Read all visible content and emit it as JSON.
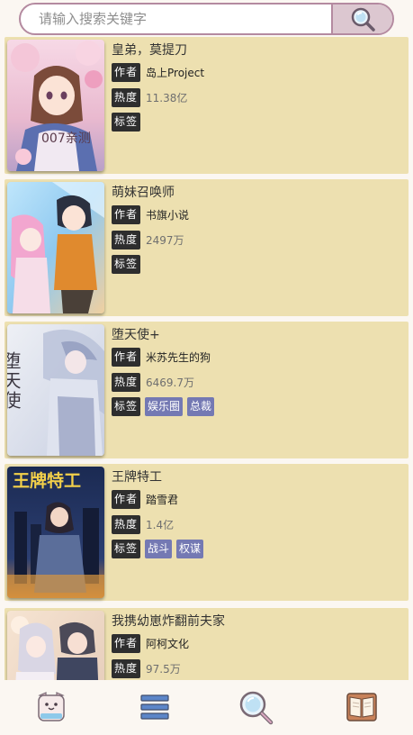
{
  "search": {
    "placeholder": "请输入搜索关键字"
  },
  "labels": {
    "author": "作者",
    "popularity": "热度",
    "tags": "标签"
  },
  "comics": [
    {
      "title": "皇弟，莫提刀",
      "author": "岛上Project",
      "popularity": "11.38亿",
      "tags": [],
      "cover_watermark": "007亲测"
    },
    {
      "title": "萌妹召唤师",
      "author": "书旗小说",
      "popularity": "2497万",
      "tags": []
    },
    {
      "title": "堕天使+",
      "author": "米苏先生的狗",
      "popularity": "6469.7万",
      "tags": [
        "娱乐圈",
        "总裁"
      ],
      "cover_text": "堕天使"
    },
    {
      "title": "王牌特工",
      "author": "踏雪君",
      "popularity": "1.4亿",
      "tags": [
        "战斗",
        "权谋"
      ],
      "cover_text": "王牌特工"
    },
    {
      "title": "我携幼崽炸翻前夫家",
      "author": "阿柯文化",
      "popularity": "97.5万",
      "tags": []
    }
  ],
  "nav": {
    "items": [
      "home-icon",
      "list-icon",
      "search-icon",
      "book-icon"
    ]
  },
  "colors": {
    "card_bg": "#ede0b0",
    "badge_bg": "#2e2e2e",
    "tag_bg": "#7479b3",
    "search_border": "#b48aa0",
    "search_button_bg": "#dcc7d0"
  }
}
